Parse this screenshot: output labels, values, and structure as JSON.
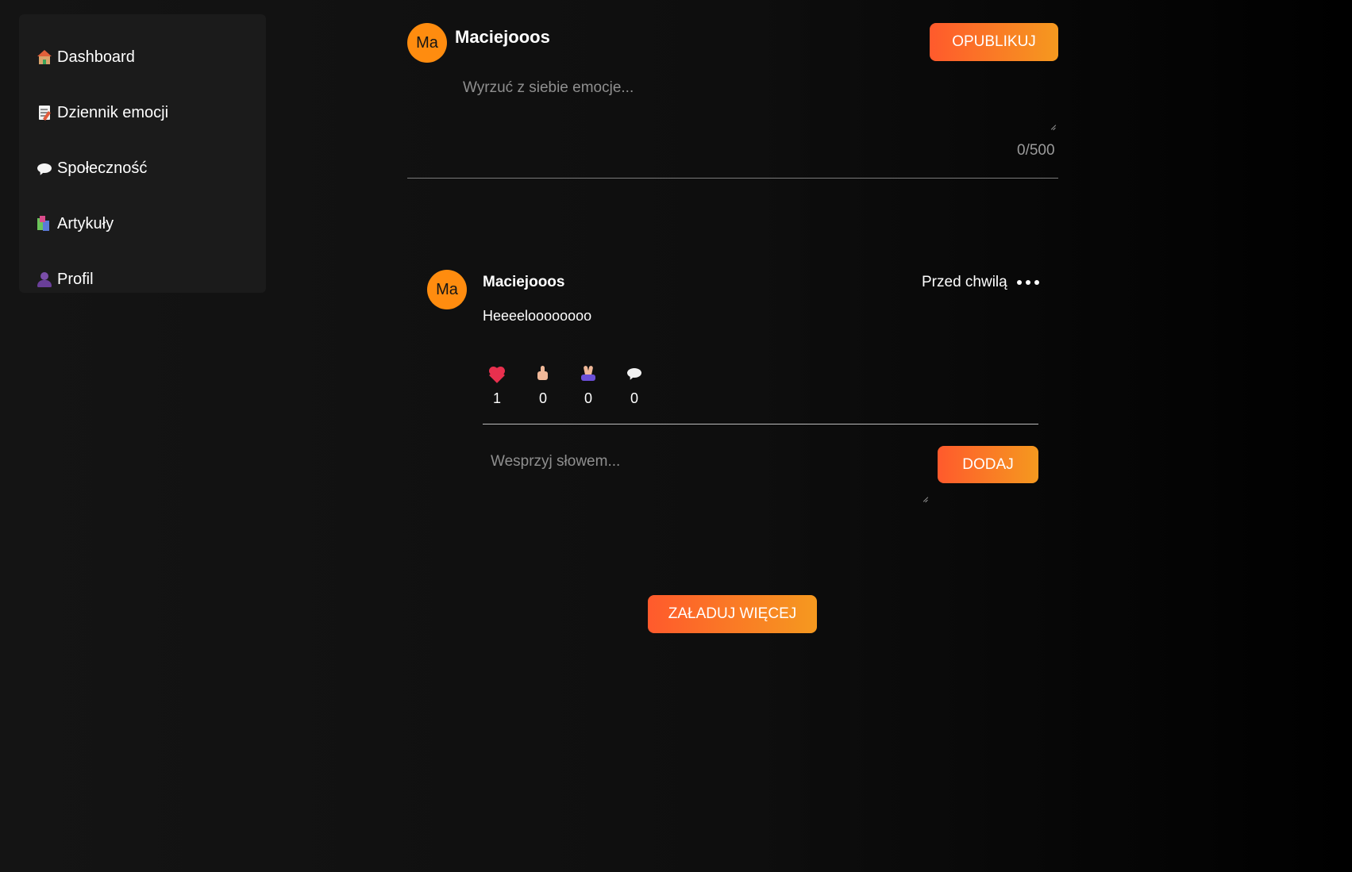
{
  "sidebar": {
    "items": [
      {
        "label": "Dashboard",
        "icon": "house-icon"
      },
      {
        "label": "Dziennik emocji",
        "icon": "memo-icon"
      },
      {
        "label": "Społeczność",
        "icon": "speech-bubble-icon"
      },
      {
        "label": "Artykuły",
        "icon": "books-icon"
      },
      {
        "label": "Profil",
        "icon": "person-icon"
      }
    ]
  },
  "composer": {
    "avatar_initials": "Ma",
    "username": "Maciejooos",
    "publish_label": "OPUBLIKUJ",
    "placeholder": "Wyrzuć z siebie emocje...",
    "value": "",
    "counter": "0/500"
  },
  "post": {
    "avatar_initials": "Ma",
    "username": "Maciejooos",
    "time": "Przed chwilą",
    "text": "Heeeeloooooooo",
    "reactions": [
      {
        "icon": "heart-icon",
        "count": "1"
      },
      {
        "icon": "thumbs-up-icon",
        "count": "0"
      },
      {
        "icon": "praying-hands-icon",
        "count": "0"
      },
      {
        "icon": "comment-icon",
        "count": "0"
      }
    ],
    "comment": {
      "placeholder": "Wesprzyj słowem...",
      "value": "",
      "add_label": "DODAJ"
    }
  },
  "load_more_label": "ZAŁADUJ WIĘCEJ",
  "colors": {
    "accent_start": "#ff5a2c",
    "accent_end": "#f5991f",
    "avatar": "#ff8c0f",
    "sidebar_bg": "#1b1b1b",
    "heart": "#e8304e"
  }
}
